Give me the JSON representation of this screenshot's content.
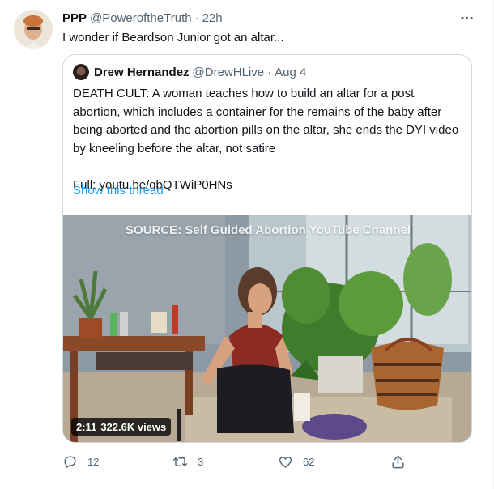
{
  "tweet": {
    "display_name": "PPP",
    "handle": "@PoweroftheTruth",
    "separator": "·",
    "time": "22h",
    "text": "I wonder if Beardson Junior got an altar..."
  },
  "quoted": {
    "display_name": "Drew Hernandez",
    "handle": "@DrewHLive",
    "separator": "·",
    "date": "Aug 4",
    "lines": [
      "DEATH CULT: A woman teaches how to build an altar for a post",
      "abortion, which includes a container for the remains of the baby after",
      "being aborted and the abortion pills on the altar, she ends the DYI video",
      "by kneeling before the altar, not satire"
    ],
    "full_label": "Full: youtu.be/qbQTWiP0HNs",
    "show_thread": "Show this thread",
    "media": {
      "overlay": "SOURCE: Self Guided Abortion YouTube Channel",
      "duration": "2:11",
      "views": "322.6K views"
    }
  },
  "actions": {
    "replies": "12",
    "retweets": "3",
    "likes": "62"
  },
  "colors": {
    "link": "#1d9bf0",
    "muted": "#536471",
    "border": "#cfd9de"
  }
}
